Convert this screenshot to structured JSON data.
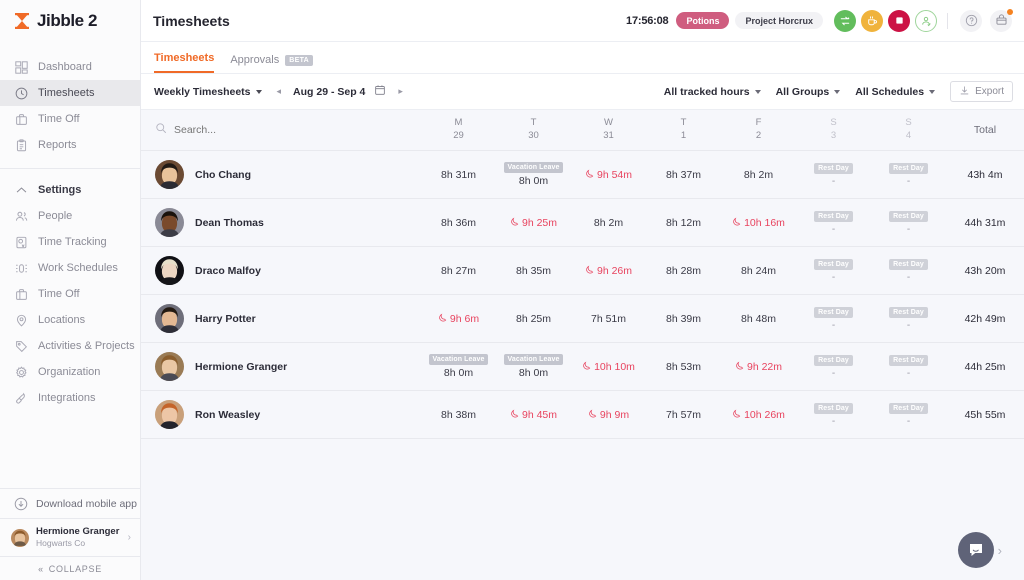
{
  "brand": {
    "name": "Jibble 2"
  },
  "sidebar": {
    "primary": [
      {
        "label": "Dashboard",
        "icon": "dashboard-icon",
        "active": false
      },
      {
        "label": "Timesheets",
        "icon": "clock-icon",
        "active": true
      },
      {
        "label": "Time Off",
        "icon": "briefcase-icon",
        "active": false
      },
      {
        "label": "Reports",
        "icon": "clipboard-icon",
        "active": false
      }
    ],
    "settings_label": "Settings",
    "secondary": [
      {
        "label": "People",
        "icon": "people-icon"
      },
      {
        "label": "Time Tracking",
        "icon": "time-tracking-icon"
      },
      {
        "label": "Work Schedules",
        "icon": "work-schedules-icon"
      },
      {
        "label": "Time Off",
        "icon": "briefcase-icon"
      },
      {
        "label": "Locations",
        "icon": "location-pin-icon"
      },
      {
        "label": "Activities & Projects",
        "icon": "tag-icon"
      },
      {
        "label": "Organization",
        "icon": "gear-icon"
      },
      {
        "label": "Integrations",
        "icon": "plug-icon"
      }
    ],
    "download_app": "Download mobile app",
    "user": {
      "name": "Hermione Granger",
      "org": "Hogwarts Co"
    },
    "collapse": "COLLAPSE"
  },
  "header": {
    "title": "Timesheets",
    "timer": "17:56:08",
    "activity_pill": "Potions",
    "project_pill": "Project Horcrux",
    "buttons": [
      {
        "name": "switch-activity-button",
        "style": "green"
      },
      {
        "name": "break-button",
        "style": "orange"
      },
      {
        "name": "stop-button",
        "style": "crimson"
      },
      {
        "name": "personal-status-button",
        "style": "ghost"
      }
    ],
    "help_icon": "help-icon",
    "notifications_icon": "notifications-icon"
  },
  "tabs": [
    {
      "label": "Timesheets",
      "active": true,
      "badge": ""
    },
    {
      "label": "Approvals",
      "active": false,
      "badge": "BETA"
    }
  ],
  "toolbar": {
    "view_select": "Weekly Timesheets",
    "prev_label": "◂",
    "next_label": "▸",
    "date_range": "Aug 29 - Sep 4",
    "calendar_icon": "calendar-icon",
    "filters": [
      "All tracked hours",
      "All Groups",
      "All Schedules"
    ],
    "export_label": "Export"
  },
  "table": {
    "search_placeholder": "Search...",
    "total_header": "Total",
    "columns": [
      {
        "dow": "M",
        "num": "29",
        "weekend": false
      },
      {
        "dow": "T",
        "num": "30",
        "weekend": false
      },
      {
        "dow": "W",
        "num": "31",
        "weekend": false
      },
      {
        "dow": "T",
        "num": "1",
        "weekend": false
      },
      {
        "dow": "F",
        "num": "2",
        "weekend": false
      },
      {
        "dow": "S",
        "num": "3",
        "weekend": true
      },
      {
        "dow": "S",
        "num": "4",
        "weekend": true
      }
    ],
    "rows": [
      {
        "name": "Cho Chang",
        "avatar": "cho",
        "days": [
          {
            "value": "8h 31m",
            "overtime": false,
            "tag": ""
          },
          {
            "value": "8h 0m",
            "overtime": false,
            "tag": "Vacation Leave"
          },
          {
            "value": "9h 54m",
            "overtime": true,
            "tag": ""
          },
          {
            "value": "8h 37m",
            "overtime": false,
            "tag": ""
          },
          {
            "value": "8h 2m",
            "overtime": false,
            "tag": ""
          },
          {
            "value": "-",
            "overtime": false,
            "tag": "Rest Day"
          },
          {
            "value": "-",
            "overtime": false,
            "tag": "Rest Day"
          }
        ],
        "total": "43h 4m"
      },
      {
        "name": "Dean Thomas",
        "avatar": "dean",
        "days": [
          {
            "value": "8h 36m",
            "overtime": false,
            "tag": ""
          },
          {
            "value": "9h 25m",
            "overtime": true,
            "tag": ""
          },
          {
            "value": "8h 2m",
            "overtime": false,
            "tag": ""
          },
          {
            "value": "8h 12m",
            "overtime": false,
            "tag": ""
          },
          {
            "value": "10h 16m",
            "overtime": true,
            "tag": ""
          },
          {
            "value": "-",
            "overtime": false,
            "tag": "Rest Day"
          },
          {
            "value": "-",
            "overtime": false,
            "tag": "Rest Day"
          }
        ],
        "total": "44h 31m"
      },
      {
        "name": "Draco Malfoy",
        "avatar": "draco",
        "days": [
          {
            "value": "8h 27m",
            "overtime": false,
            "tag": ""
          },
          {
            "value": "8h 35m",
            "overtime": false,
            "tag": ""
          },
          {
            "value": "9h 26m",
            "overtime": true,
            "tag": ""
          },
          {
            "value": "8h 28m",
            "overtime": false,
            "tag": ""
          },
          {
            "value": "8h 24m",
            "overtime": false,
            "tag": ""
          },
          {
            "value": "-",
            "overtime": false,
            "tag": "Rest Day"
          },
          {
            "value": "-",
            "overtime": false,
            "tag": "Rest Day"
          }
        ],
        "total": "43h 20m"
      },
      {
        "name": "Harry Potter",
        "avatar": "harry",
        "days": [
          {
            "value": "9h 6m",
            "overtime": true,
            "tag": ""
          },
          {
            "value": "8h 25m",
            "overtime": false,
            "tag": ""
          },
          {
            "value": "7h 51m",
            "overtime": false,
            "tag": ""
          },
          {
            "value": "8h 39m",
            "overtime": false,
            "tag": ""
          },
          {
            "value": "8h 48m",
            "overtime": false,
            "tag": ""
          },
          {
            "value": "-",
            "overtime": false,
            "tag": "Rest Day"
          },
          {
            "value": "-",
            "overtime": false,
            "tag": "Rest Day"
          }
        ],
        "total": "42h 49m"
      },
      {
        "name": "Hermione Granger",
        "avatar": "hermione",
        "days": [
          {
            "value": "8h 0m",
            "overtime": false,
            "tag": "Vacation Leave"
          },
          {
            "value": "8h 0m",
            "overtime": false,
            "tag": "Vacation Leave"
          },
          {
            "value": "10h 10m",
            "overtime": true,
            "tag": ""
          },
          {
            "value": "8h 53m",
            "overtime": false,
            "tag": ""
          },
          {
            "value": "9h 22m",
            "overtime": true,
            "tag": ""
          },
          {
            "value": "-",
            "overtime": false,
            "tag": "Rest Day"
          },
          {
            "value": "-",
            "overtime": false,
            "tag": "Rest Day"
          }
        ],
        "total": "44h 25m"
      },
      {
        "name": "Ron Weasley",
        "avatar": "ron",
        "days": [
          {
            "value": "8h 38m",
            "overtime": false,
            "tag": ""
          },
          {
            "value": "9h 45m",
            "overtime": true,
            "tag": ""
          },
          {
            "value": "9h 9m",
            "overtime": true,
            "tag": ""
          },
          {
            "value": "7h 57m",
            "overtime": false,
            "tag": ""
          },
          {
            "value": "10h 26m",
            "overtime": true,
            "tag": ""
          },
          {
            "value": "-",
            "overtime": false,
            "tag": "Rest Day"
          },
          {
            "value": "-",
            "overtime": false,
            "tag": "Rest Day"
          }
        ],
        "total": "45h 55m"
      }
    ]
  },
  "chat": {
    "icon": "chat-bubble-icon",
    "expand": "›"
  },
  "colors": {
    "accent": "#f06a27",
    "overtime": "#e8445f",
    "activity_pill": "#cf5d7f",
    "stop": "#cc1244",
    "break": "#f0b33c",
    "switch": "#62bd5c",
    "tag_gray": "#c3c5ce",
    "bg": "#f6f7fb"
  }
}
